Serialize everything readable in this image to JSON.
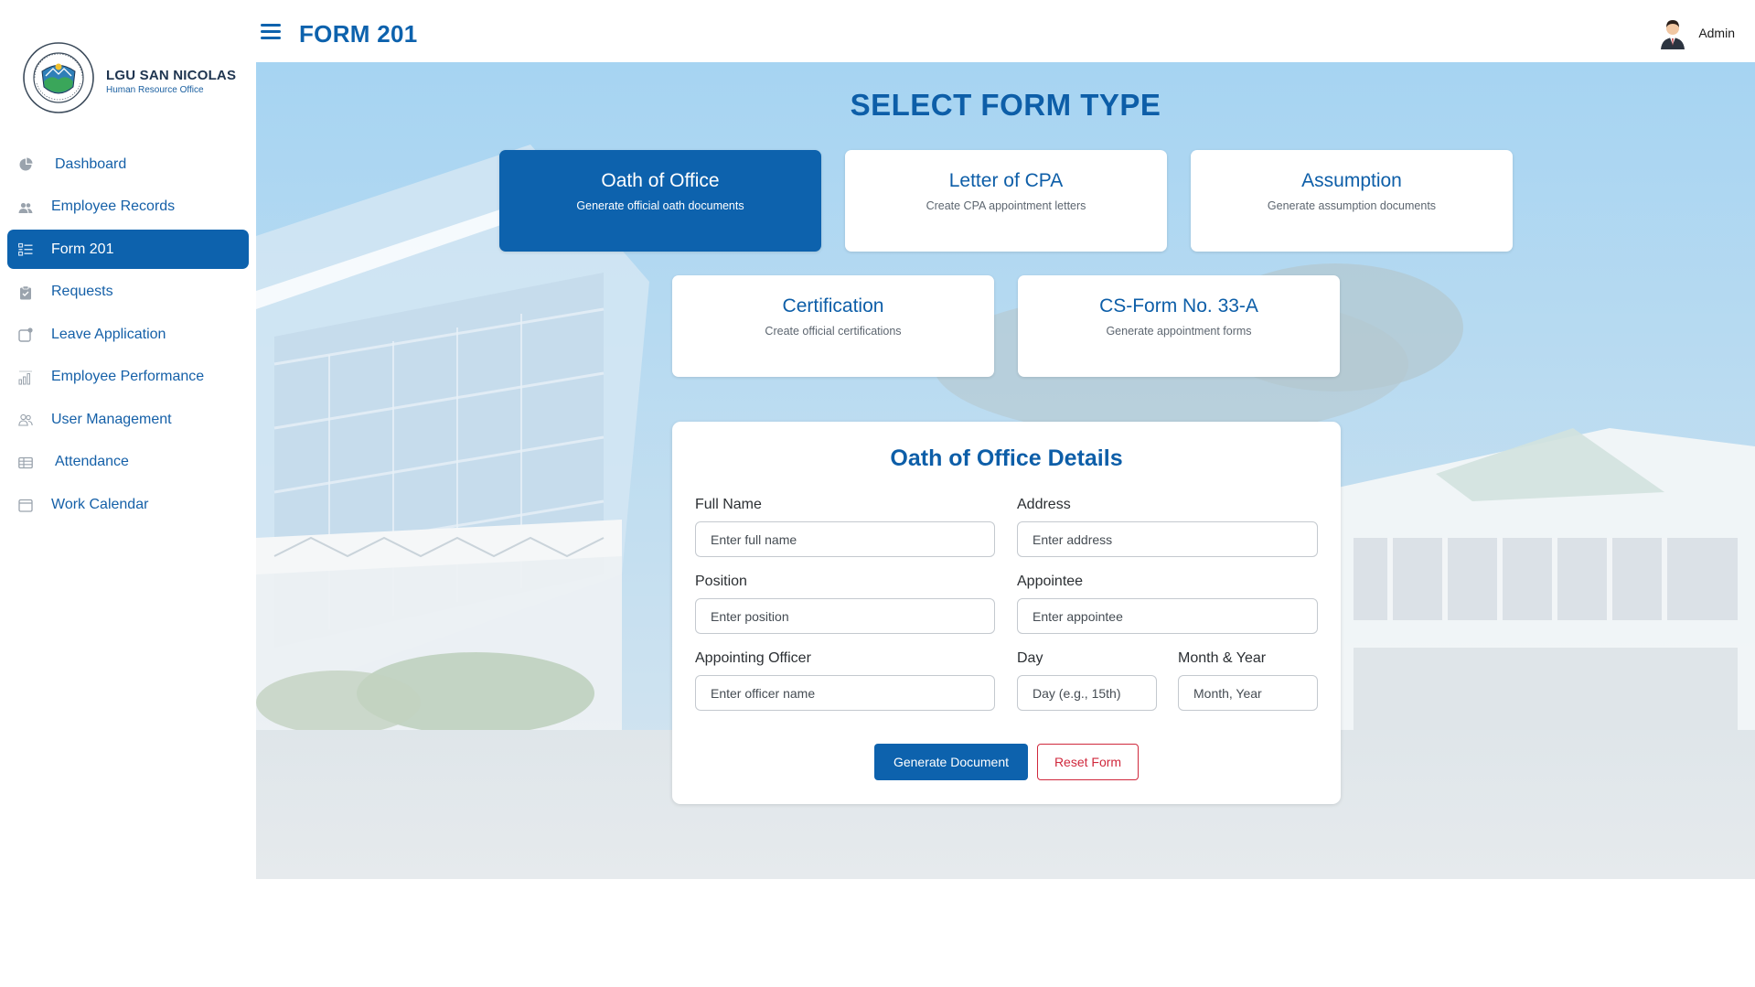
{
  "brand": {
    "name": "LGU SAN NICOLAS",
    "subtitle": "Human Resource Office",
    "seal_text_top": "BAYAN NG SAN NICOLAS",
    "seal_text_bottom": "LALAWIGAN NG BATANGAS"
  },
  "header": {
    "title": "FORM 201",
    "user_name": "Admin"
  },
  "sidebar": {
    "items": [
      {
        "label": "Dashboard",
        "icon": "pie-chart-icon"
      },
      {
        "label": "Employee Records",
        "icon": "users-icon"
      },
      {
        "label": "Form 201",
        "icon": "list-icon",
        "active": true
      },
      {
        "label": "Requests",
        "icon": "clipboard-icon"
      },
      {
        "label": "Leave Application",
        "icon": "leave-icon"
      },
      {
        "label": "Employee Performance",
        "icon": "bar-chart-icon"
      },
      {
        "label": "User Management",
        "icon": "user-group-icon"
      },
      {
        "label": "Attendance",
        "icon": "table-icon"
      },
      {
        "label": "Work Calendar",
        "icon": "calendar-icon"
      }
    ]
  },
  "main": {
    "section_title": "SELECT FORM TYPE",
    "form_types": [
      {
        "title": "Oath of Office",
        "description": "Generate official oath documents",
        "active": true
      },
      {
        "title": "Letter of CPA",
        "description": "Create CPA appointment letters"
      },
      {
        "title": "Assumption",
        "description": "Generate assumption documents"
      },
      {
        "title": "Certification",
        "description": "Create official certifications"
      },
      {
        "title": "CS-Form No. 33-A",
        "description": "Generate appointment forms"
      }
    ],
    "details": {
      "title": "Oath of Office Details",
      "fields": {
        "full_name": {
          "label": "Full Name",
          "placeholder": "Enter full name",
          "value": ""
        },
        "address": {
          "label": "Address",
          "placeholder": "Enter address",
          "value": ""
        },
        "position": {
          "label": "Position",
          "placeholder": "Enter position",
          "value": ""
        },
        "appointee": {
          "label": "Appointee",
          "placeholder": "Enter appointee",
          "value": ""
        },
        "appointing_officer": {
          "label": "Appointing Officer",
          "placeholder": "Enter officer name",
          "value": ""
        },
        "day": {
          "label": "Day",
          "placeholder": "Day (e.g., 15th)",
          "value": ""
        },
        "month_year": {
          "label": "Month & Year",
          "placeholder": "Month, Year",
          "value": ""
        }
      },
      "generate_label": "Generate Document",
      "reset_label": "Reset Form"
    }
  },
  "colors": {
    "primary": "#0d62ad",
    "danger": "#d0293d",
    "sidebar_text": "#1560a8"
  }
}
